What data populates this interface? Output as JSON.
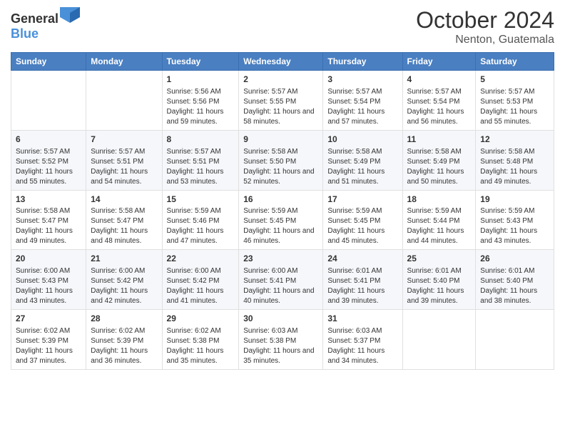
{
  "header": {
    "logo_general": "General",
    "logo_blue": "Blue",
    "month": "October 2024",
    "location": "Nenton, Guatemala"
  },
  "days_of_week": [
    "Sunday",
    "Monday",
    "Tuesday",
    "Wednesday",
    "Thursday",
    "Friday",
    "Saturday"
  ],
  "weeks": [
    [
      {
        "day": "",
        "content": ""
      },
      {
        "day": "",
        "content": ""
      },
      {
        "day": "1",
        "content": "Sunrise: 5:56 AM\nSunset: 5:56 PM\nDaylight: 11 hours and 59 minutes."
      },
      {
        "day": "2",
        "content": "Sunrise: 5:57 AM\nSunset: 5:55 PM\nDaylight: 11 hours and 58 minutes."
      },
      {
        "day": "3",
        "content": "Sunrise: 5:57 AM\nSunset: 5:54 PM\nDaylight: 11 hours and 57 minutes."
      },
      {
        "day": "4",
        "content": "Sunrise: 5:57 AM\nSunset: 5:54 PM\nDaylight: 11 hours and 56 minutes."
      },
      {
        "day": "5",
        "content": "Sunrise: 5:57 AM\nSunset: 5:53 PM\nDaylight: 11 hours and 55 minutes."
      }
    ],
    [
      {
        "day": "6",
        "content": "Sunrise: 5:57 AM\nSunset: 5:52 PM\nDaylight: 11 hours and 55 minutes."
      },
      {
        "day": "7",
        "content": "Sunrise: 5:57 AM\nSunset: 5:51 PM\nDaylight: 11 hours and 54 minutes."
      },
      {
        "day": "8",
        "content": "Sunrise: 5:57 AM\nSunset: 5:51 PM\nDaylight: 11 hours and 53 minutes."
      },
      {
        "day": "9",
        "content": "Sunrise: 5:58 AM\nSunset: 5:50 PM\nDaylight: 11 hours and 52 minutes."
      },
      {
        "day": "10",
        "content": "Sunrise: 5:58 AM\nSunset: 5:49 PM\nDaylight: 11 hours and 51 minutes."
      },
      {
        "day": "11",
        "content": "Sunrise: 5:58 AM\nSunset: 5:49 PM\nDaylight: 11 hours and 50 minutes."
      },
      {
        "day": "12",
        "content": "Sunrise: 5:58 AM\nSunset: 5:48 PM\nDaylight: 11 hours and 49 minutes."
      }
    ],
    [
      {
        "day": "13",
        "content": "Sunrise: 5:58 AM\nSunset: 5:47 PM\nDaylight: 11 hours and 49 minutes."
      },
      {
        "day": "14",
        "content": "Sunrise: 5:58 AM\nSunset: 5:47 PM\nDaylight: 11 hours and 48 minutes."
      },
      {
        "day": "15",
        "content": "Sunrise: 5:59 AM\nSunset: 5:46 PM\nDaylight: 11 hours and 47 minutes."
      },
      {
        "day": "16",
        "content": "Sunrise: 5:59 AM\nSunset: 5:45 PM\nDaylight: 11 hours and 46 minutes."
      },
      {
        "day": "17",
        "content": "Sunrise: 5:59 AM\nSunset: 5:45 PM\nDaylight: 11 hours and 45 minutes."
      },
      {
        "day": "18",
        "content": "Sunrise: 5:59 AM\nSunset: 5:44 PM\nDaylight: 11 hours and 44 minutes."
      },
      {
        "day": "19",
        "content": "Sunrise: 5:59 AM\nSunset: 5:43 PM\nDaylight: 11 hours and 43 minutes."
      }
    ],
    [
      {
        "day": "20",
        "content": "Sunrise: 6:00 AM\nSunset: 5:43 PM\nDaylight: 11 hours and 43 minutes."
      },
      {
        "day": "21",
        "content": "Sunrise: 6:00 AM\nSunset: 5:42 PM\nDaylight: 11 hours and 42 minutes."
      },
      {
        "day": "22",
        "content": "Sunrise: 6:00 AM\nSunset: 5:42 PM\nDaylight: 11 hours and 41 minutes."
      },
      {
        "day": "23",
        "content": "Sunrise: 6:00 AM\nSunset: 5:41 PM\nDaylight: 11 hours and 40 minutes."
      },
      {
        "day": "24",
        "content": "Sunrise: 6:01 AM\nSunset: 5:41 PM\nDaylight: 11 hours and 39 minutes."
      },
      {
        "day": "25",
        "content": "Sunrise: 6:01 AM\nSunset: 5:40 PM\nDaylight: 11 hours and 39 minutes."
      },
      {
        "day": "26",
        "content": "Sunrise: 6:01 AM\nSunset: 5:40 PM\nDaylight: 11 hours and 38 minutes."
      }
    ],
    [
      {
        "day": "27",
        "content": "Sunrise: 6:02 AM\nSunset: 5:39 PM\nDaylight: 11 hours and 37 minutes."
      },
      {
        "day": "28",
        "content": "Sunrise: 6:02 AM\nSunset: 5:39 PM\nDaylight: 11 hours and 36 minutes."
      },
      {
        "day": "29",
        "content": "Sunrise: 6:02 AM\nSunset: 5:38 PM\nDaylight: 11 hours and 35 minutes."
      },
      {
        "day": "30",
        "content": "Sunrise: 6:03 AM\nSunset: 5:38 PM\nDaylight: 11 hours and 35 minutes."
      },
      {
        "day": "31",
        "content": "Sunrise: 6:03 AM\nSunset: 5:37 PM\nDaylight: 11 hours and 34 minutes."
      },
      {
        "day": "",
        "content": ""
      },
      {
        "day": "",
        "content": ""
      }
    ]
  ]
}
